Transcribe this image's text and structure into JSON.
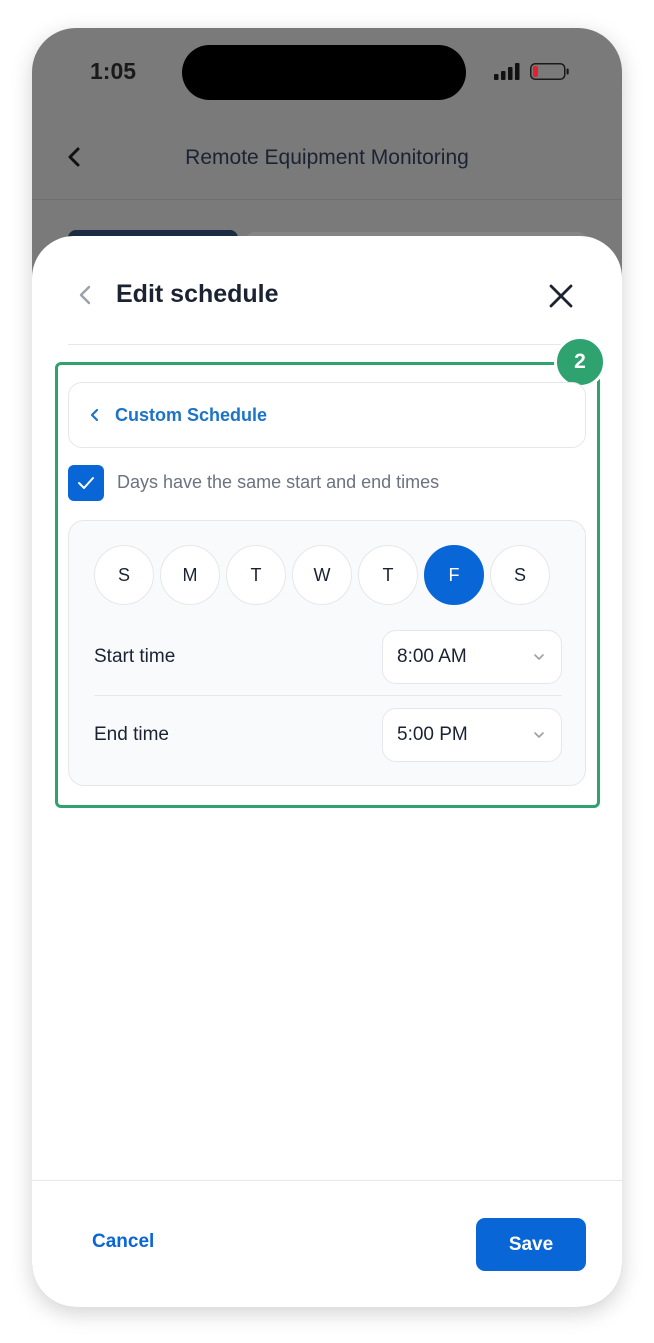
{
  "status_bar": {
    "time": "1:05"
  },
  "background_screen": {
    "title": "Remote Equipment Monitoring"
  },
  "sheet": {
    "title": "Edit schedule",
    "step_badge": "2",
    "custom_schedule_label": "Custom Schedule",
    "same_times_checkbox": {
      "label": "Days have the same start and end times",
      "checked": true
    },
    "days": [
      {
        "label": "S",
        "selected": false
      },
      {
        "label": "M",
        "selected": false
      },
      {
        "label": "T",
        "selected": false
      },
      {
        "label": "W",
        "selected": false
      },
      {
        "label": "T",
        "selected": false
      },
      {
        "label": "F",
        "selected": true
      },
      {
        "label": "S",
        "selected": false
      }
    ],
    "start_time": {
      "label": "Start time",
      "value": "8:00 AM"
    },
    "end_time": {
      "label": "End time",
      "value": "5:00 PM"
    }
  },
  "footer": {
    "cancel_label": "Cancel",
    "save_label": "Save"
  },
  "colors": {
    "accent": "#0866d6",
    "highlight": "#2ea370",
    "text": "#1b2333"
  },
  "icons": [
    "signal-icon",
    "battery-icon",
    "back-icon",
    "close-icon",
    "chevron-left-icon",
    "check-icon",
    "chevron-down-icon"
  ]
}
